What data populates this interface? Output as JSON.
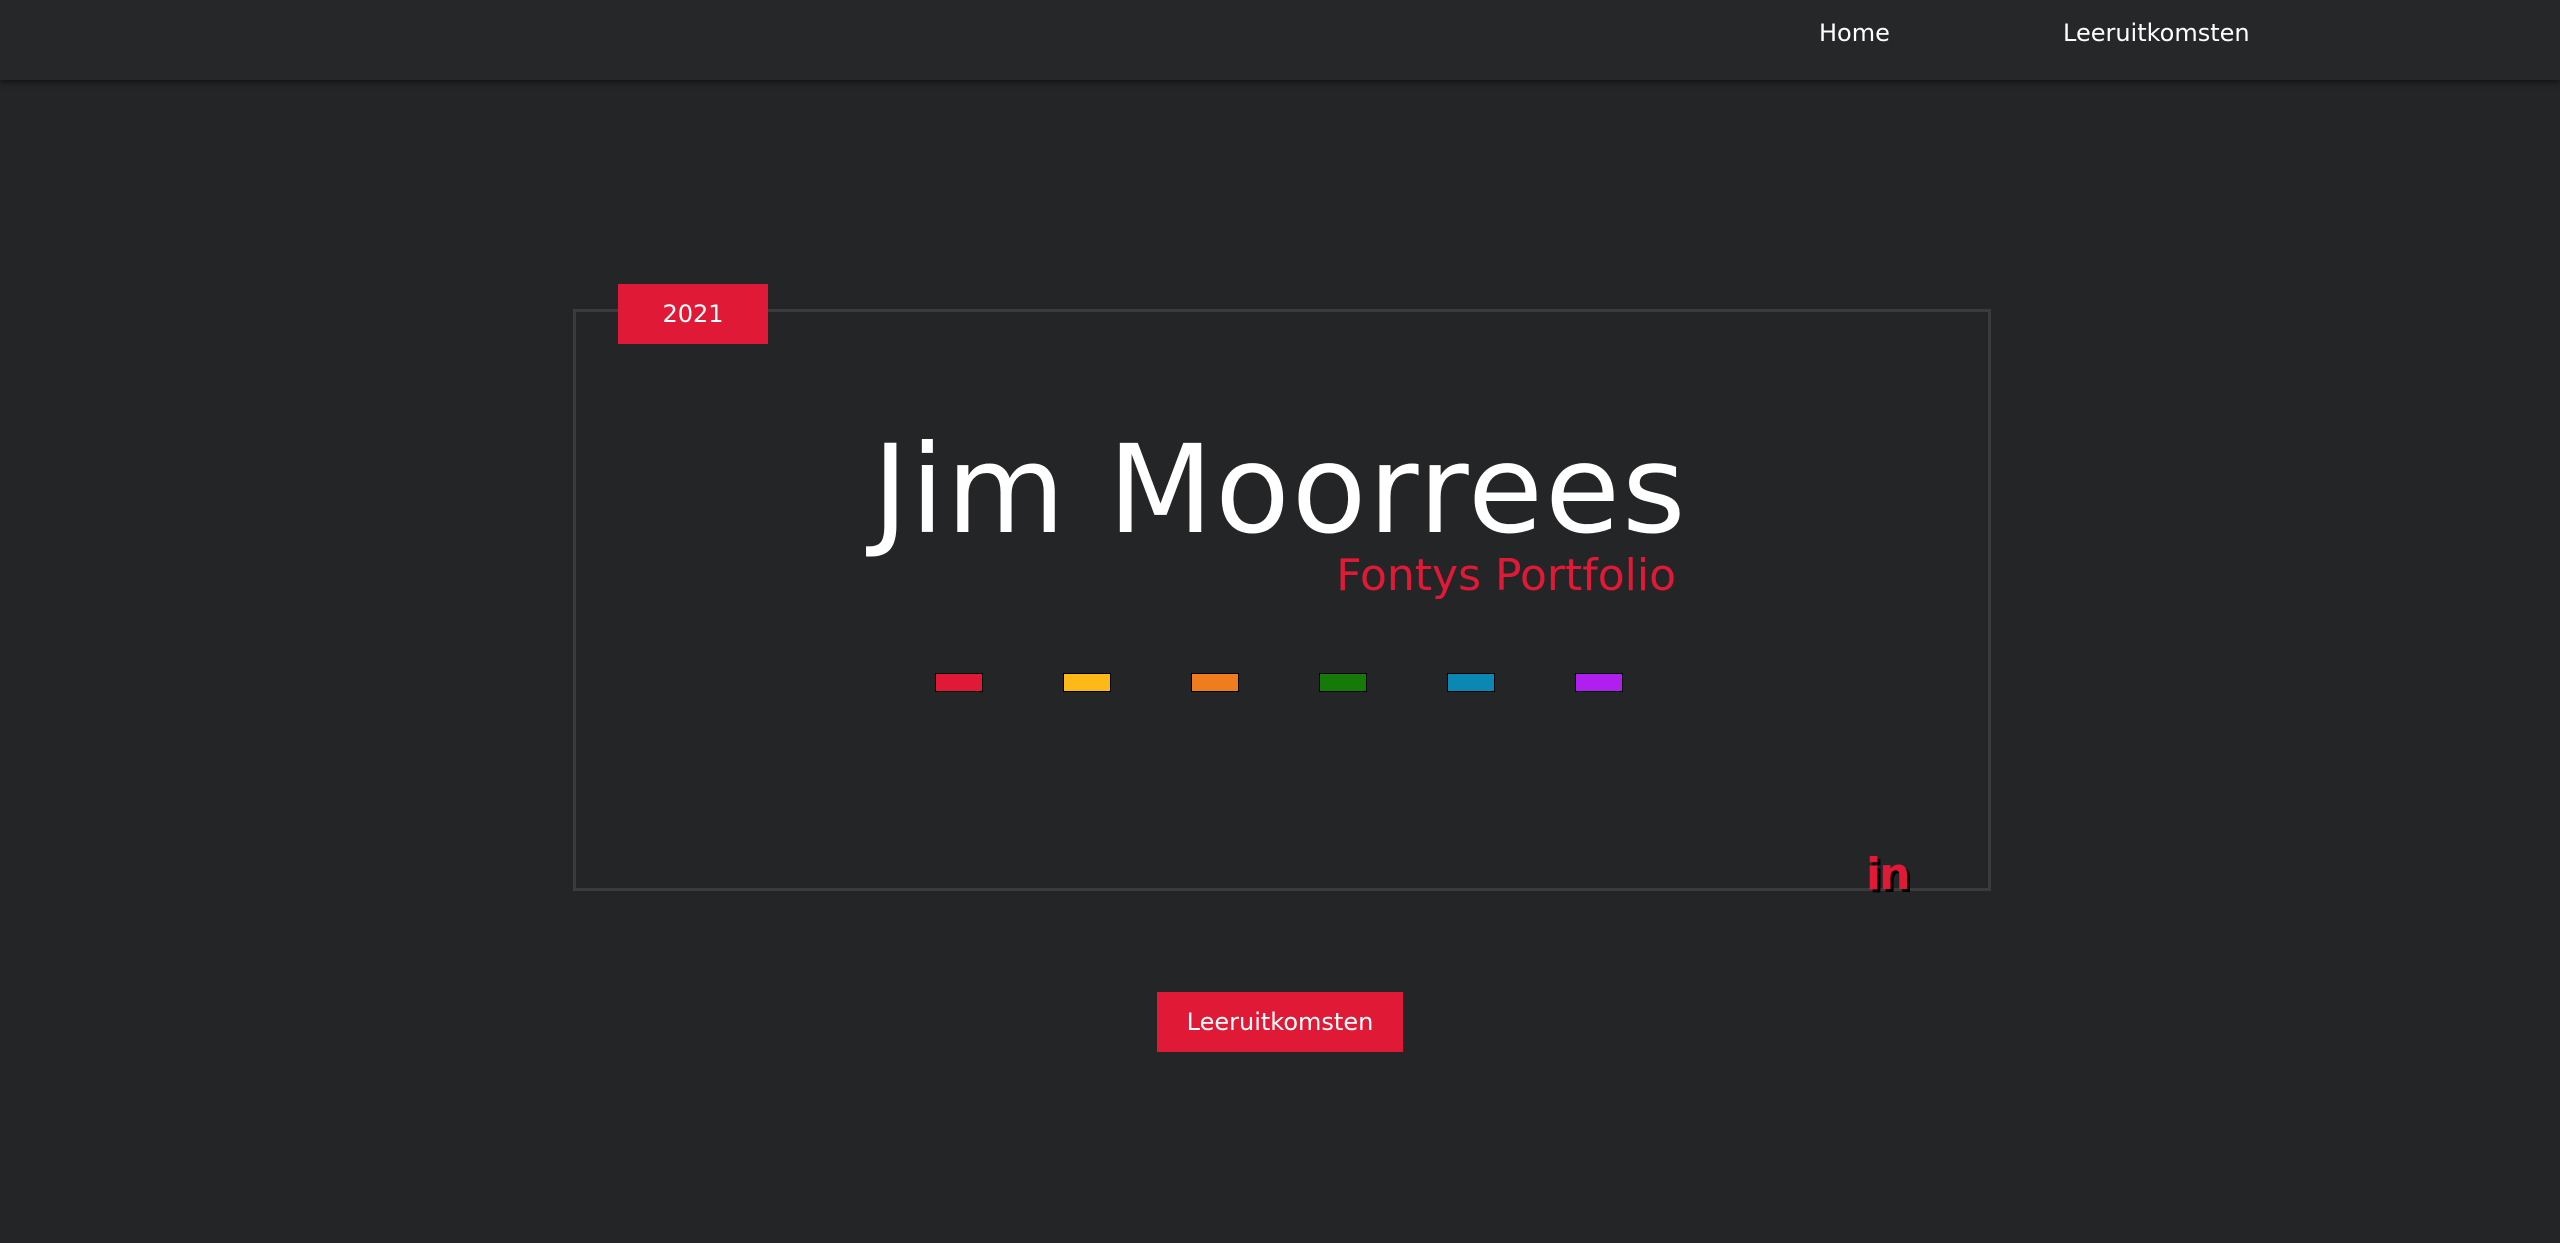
{
  "nav": {
    "home_label": "Home",
    "leeruitkomsten_label": "Leeruitkomsten"
  },
  "hero": {
    "year": "2021",
    "name": "Jim Moorrees",
    "subtitle": "Fontys Portfolio",
    "linkedin_icon": "in",
    "cta_label": "Leeruitkomsten"
  },
  "swatches": [
    {
      "color": "#e01936"
    },
    {
      "color": "#fcb918"
    },
    {
      "color": "#ef7c1f"
    },
    {
      "color": "#167a08"
    },
    {
      "color": "#0b87b4"
    },
    {
      "color": "#b01ff0"
    }
  ],
  "colors": {
    "accent": "#e01936",
    "background": "#242527",
    "topbar": "#262729",
    "card_border": "#3a3b3d"
  }
}
